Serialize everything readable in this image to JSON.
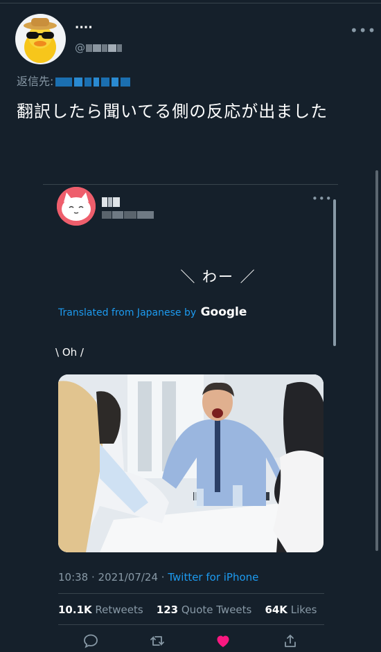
{
  "main_tweet": {
    "display_name": "∙∙∙∙",
    "handle_prefix": "@",
    "reply_to_label": "返信先:",
    "text": "翻訳したら聞いてる側の反応が出ました"
  },
  "quoted_tweet": {
    "text_japanese": "＼ わー ／",
    "translated_label": "Translated from Japanese by",
    "translated_brand": "Google",
    "translation": "\\ Oh /",
    "image_icon": "office-meeting-photo"
  },
  "meta": {
    "time": "10:38",
    "sep1": " · ",
    "date": "2021/07/24",
    "sep2": " · ",
    "client": "Twitter for iPhone"
  },
  "stats": {
    "retweets_count": "10.1K",
    "retweets_label": "Retweets",
    "quote_count": "123",
    "quote_label": "Quote Tweets",
    "likes_count": "64K",
    "likes_label": "Likes"
  },
  "actions": {
    "icons": [
      "reply-icon",
      "retweet-icon",
      "like-icon",
      "share-icon"
    ],
    "like_color": "#f91880",
    "icon_color": "#8899a6"
  },
  "colors": {
    "background": "#15202b",
    "accent": "#1d9bf0",
    "secondary_text": "#8899a6",
    "border": "#38444d"
  }
}
